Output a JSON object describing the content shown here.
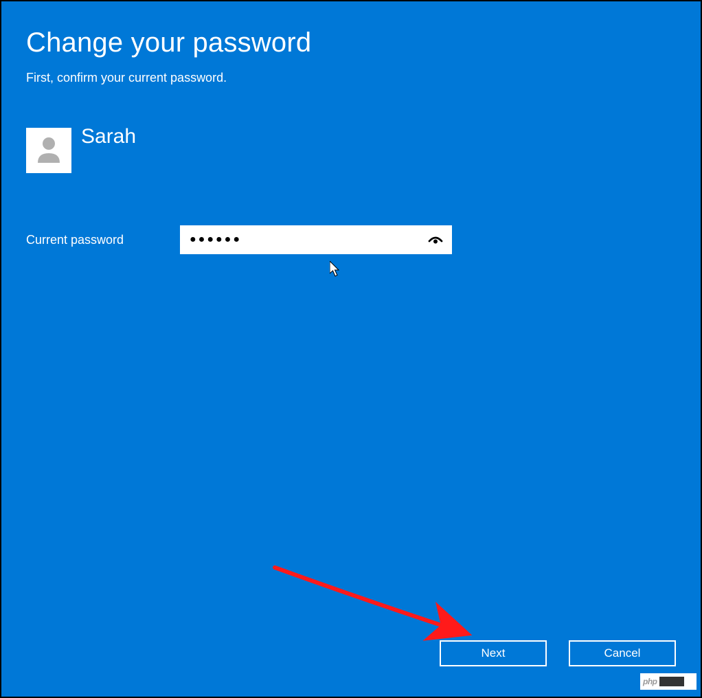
{
  "title": "Change your password",
  "subtitle": "First, confirm your current password.",
  "user": {
    "name": "Sarah"
  },
  "field": {
    "label": "Current password",
    "value": "●●●●●●"
  },
  "buttons": {
    "next": "Next",
    "cancel": "Cancel"
  },
  "watermark": "php",
  "colors": {
    "background": "#0078d7",
    "text": "#ffffff",
    "input_bg": "#ffffff"
  },
  "icons": {
    "avatar": "person-icon",
    "reveal": "eye-reveal-icon"
  }
}
